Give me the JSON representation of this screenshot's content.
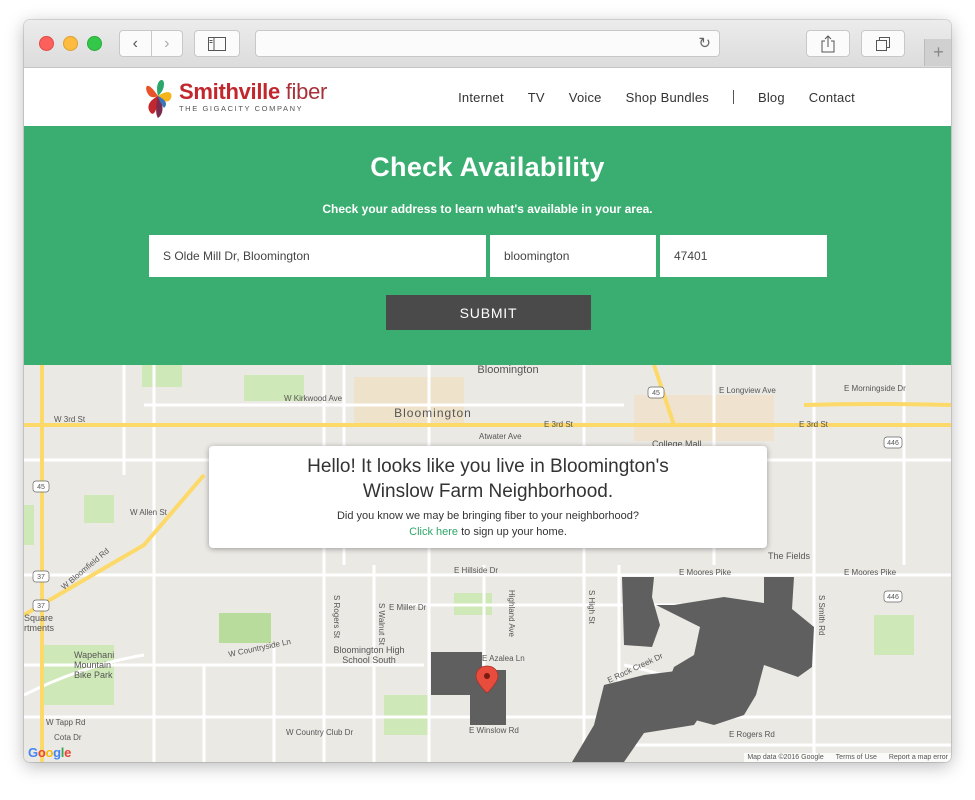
{
  "browser": {
    "back_glyph": "‹",
    "forward_glyph": "›",
    "reload_glyph": "↻",
    "newtab_glyph": "+"
  },
  "site": {
    "logo": {
      "brand": "Smithville",
      "brand_suffix": "fiber",
      "tagline": "THE GIGACITY COMPANY"
    },
    "nav": [
      {
        "label": "Internet"
      },
      {
        "label": "TV"
      },
      {
        "label": "Voice"
      },
      {
        "label": "Shop Bundles"
      },
      {
        "label": "Blog"
      },
      {
        "label": "Contact"
      }
    ]
  },
  "hero": {
    "title": "Check Availability",
    "subtitle": "Check your address to learn what's available in your area.",
    "address_value": "S Olde Mill Dr, Bloomington",
    "city_value": "bloomington",
    "zip_value": "47401",
    "submit_label": "SUBMIT",
    "bg_color": "#3aae71"
  },
  "popup": {
    "line1": "Hello! It looks like you live in Bloomington's",
    "line2": "Winslow Farm Neighborhood.",
    "line3": "Did you know we may be bringing fiber to your neighborhood?",
    "link_text": "Click here",
    "link_suffix": " to sign up your home."
  },
  "map": {
    "labels": {
      "bloomington_top": "Bloomington",
      "bloomington_center": "Bloomington",
      "w3rd": "W 3rd St",
      "e3rd": "E 3rd St",
      "e3rd_right": "E 3rd St",
      "w_kirkwood": "W Kirkwood Ave",
      "atwater": "Atwater Ave",
      "college_mall": "College Mall",
      "w_bloomfield": "W Bloomfield Rd",
      "w_allen": "W Allen St",
      "e_hillside": "E Hillside Dr",
      "e_moores": "E Moores Pike",
      "e_moores_right": "E Moores Pike",
      "e_miller": "E Miller Dr",
      "the_fields": "The Fields",
      "square_apts_1": "Square",
      "square_apts_2": "rtments",
      "wapehani_1": "Wapehani",
      "wapehani_2": "Mountain",
      "wapehani_3": "Bike Park",
      "school_1": "Bloomington High",
      "school_2": "School South",
      "w_countryside": "W Countryside Ln",
      "w_tapp": "W Tapp Rd",
      "w_country_club": "W Country Club Dr",
      "e_winslow": "E Winslow Rd",
      "e_rogers": "E Rogers Rd",
      "e_longview": "E Longview Ave",
      "e_morningside": "E Morningside Dr",
      "s_rogers": "S Rogers St",
      "s_walnut": "S Walnut St",
      "s_high": "S High St",
      "s_smith": "S Smith Rd",
      "e_azalea": "E Azalea Ln",
      "e_rock_creek": "E Rock Creek Dr",
      "highland": "Highland Ave",
      "cota": "Cota Dr",
      "r37a": "37",
      "r37b": "37",
      "r45": "45",
      "r45b": "45",
      "r446a": "446",
      "r446b": "446"
    },
    "attribution": {
      "google": "Google",
      "map_data": "Map data ©2016 Google",
      "terms": "Terms of Use",
      "report": "Report a map error"
    }
  }
}
